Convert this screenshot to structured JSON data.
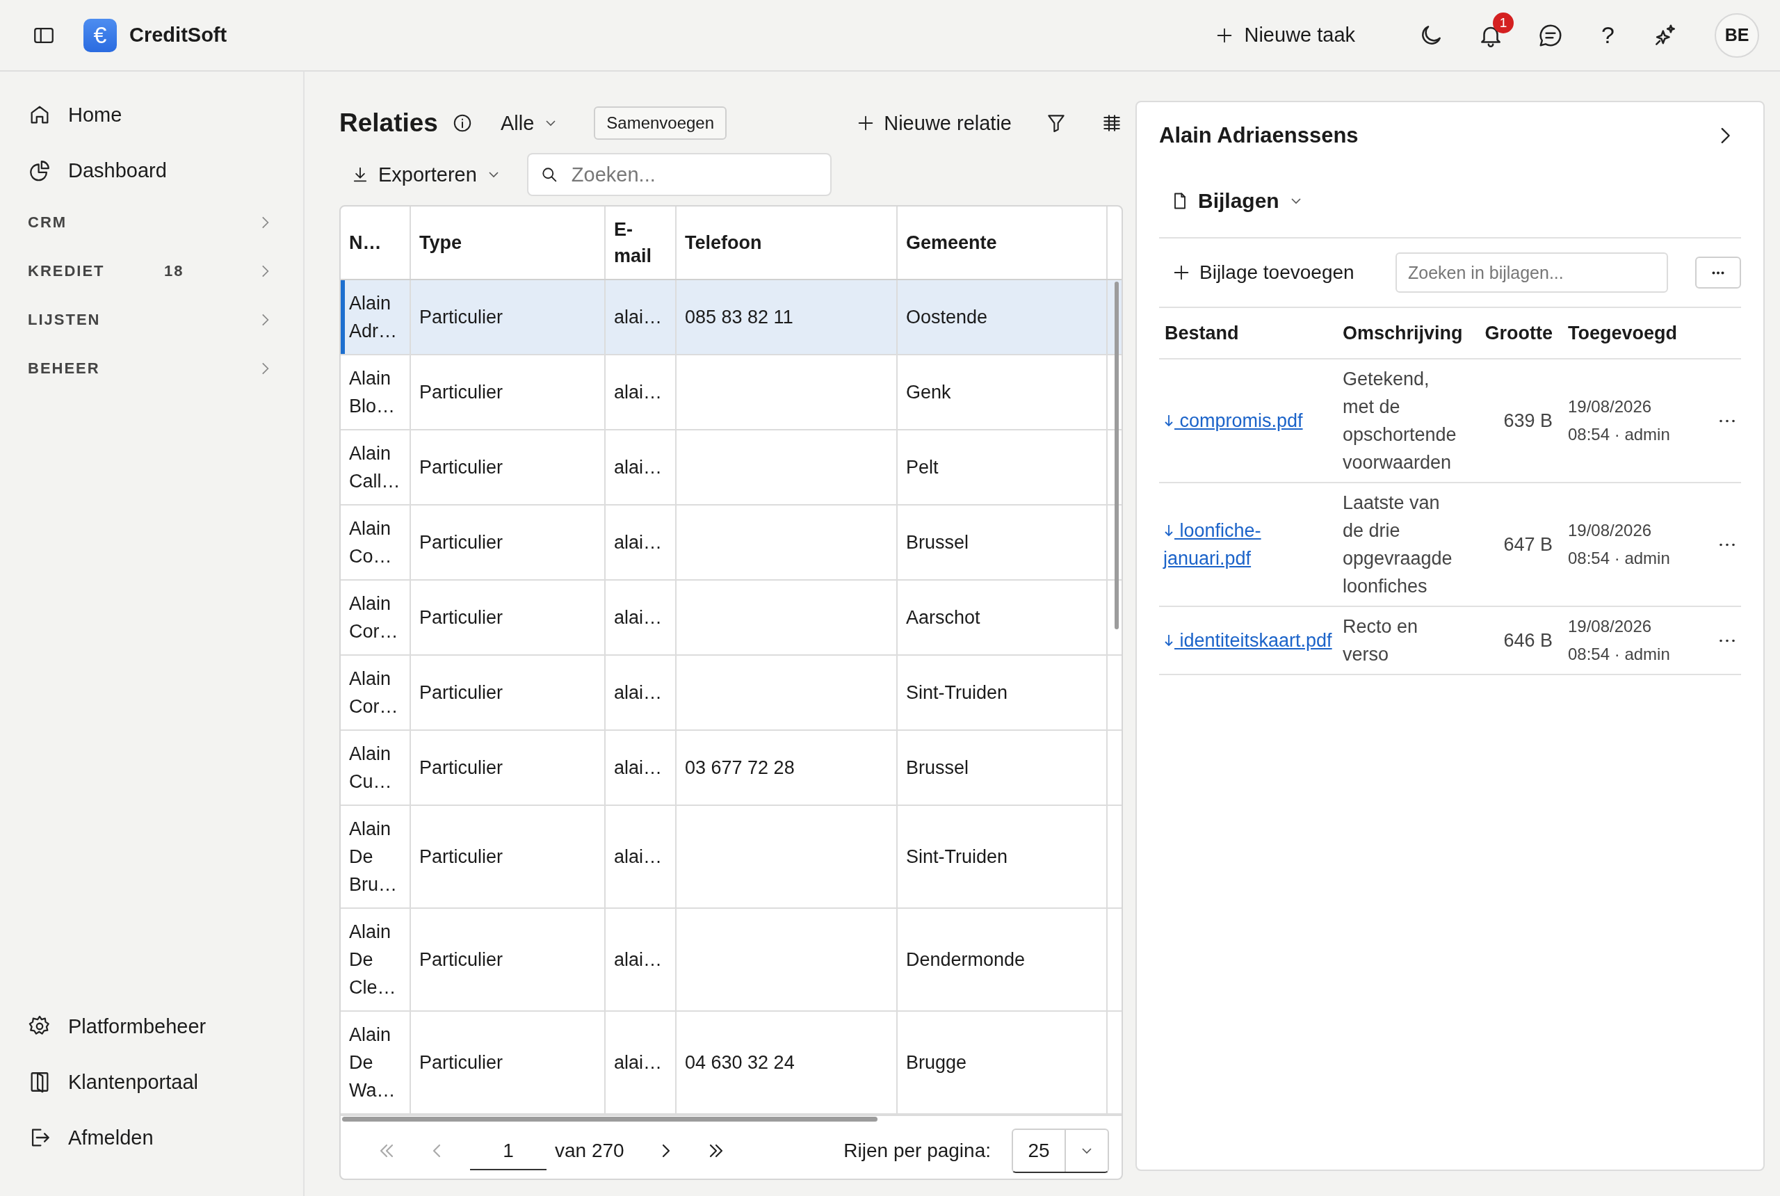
{
  "topbar": {
    "logo_symbol": "€",
    "app_name": "CreditSoft",
    "new_task": "Nieuwe taak",
    "notification_count": "1",
    "help": "?",
    "avatar": "BE"
  },
  "sidebar": {
    "top_items": [
      {
        "label": "Home"
      },
      {
        "label": "Dashboard"
      }
    ],
    "sections": [
      {
        "label": "CRM",
        "expanded": false
      },
      {
        "label": "KREDIET",
        "count": "18",
        "expanded": false
      },
      {
        "label": "LIJSTEN",
        "expanded": false
      },
      {
        "label": "BEHEER",
        "expanded": false
      }
    ],
    "bottom_items": [
      {
        "label": "Platformbeheer"
      },
      {
        "label": "Klantenportaal"
      },
      {
        "label": "Afmelden"
      }
    ]
  },
  "relaties": {
    "title": "Relaties",
    "filter": "Alle",
    "merge": "Samenvoegen",
    "new": "Nieuwe relatie",
    "export": "Exporteren",
    "search_placeholder": "Zoeken...",
    "columns": [
      "N…",
      "Type",
      "E-mail",
      "Telefoon",
      "Gemeente"
    ],
    "rows": [
      {
        "name": "Alain Adr…",
        "type": "Particulier",
        "email": "alai…",
        "phone": "085 83 82 11",
        "city": "Oostende",
        "selected": true
      },
      {
        "name": "Alain Blo…",
        "type": "Particulier",
        "email": "alai…",
        "phone": "",
        "city": "Genk",
        "selected": false
      },
      {
        "name": "Alain Call…",
        "type": "Particulier",
        "email": "alai…",
        "phone": "",
        "city": "Pelt",
        "selected": false
      },
      {
        "name": "Alain Co…",
        "type": "Particulier",
        "email": "alai…",
        "phone": "",
        "city": "Brussel",
        "selected": false
      },
      {
        "name": "Alain Cor…",
        "type": "Particulier",
        "email": "alai…",
        "phone": "",
        "city": "Aarschot",
        "selected": false
      },
      {
        "name": "Alain Cor…",
        "type": "Particulier",
        "email": "alai…",
        "phone": "",
        "city": "Sint-Truiden",
        "selected": false
      },
      {
        "name": "Alain Cu…",
        "type": "Particulier",
        "email": "alai…",
        "phone": "03 677 72 28",
        "city": "Brussel",
        "selected": false
      },
      {
        "name": "Alain De Bru…",
        "type": "Particulier",
        "email": "alai…",
        "phone": "",
        "city": "Sint-Truiden",
        "selected": false
      },
      {
        "name": "Alain De Cle…",
        "type": "Particulier",
        "email": "alai…",
        "phone": "",
        "city": "Dendermonde",
        "selected": false
      },
      {
        "name": "Alain De Wa…",
        "type": "Particulier",
        "email": "alai…",
        "phone": "04 630 32 24",
        "city": "Brugge",
        "selected": false
      }
    ],
    "pagination": {
      "nav": [
        {
          "disabled": true
        },
        {
          "disabled": true
        },
        {
          "disabled": false
        },
        {
          "disabled": false
        }
      ],
      "page": "1",
      "of": "van 270",
      "rows_label": "Rijen per pagina:",
      "rows_per_page": "25"
    }
  },
  "detail": {
    "title": "Alain Adriaenssens",
    "section": "Bijlagen",
    "add": "Bijlage toevoegen",
    "search_placeholder": "Zoeken in bijlagen...",
    "columns": [
      "Bestand",
      "Omschrijving",
      "Grootte",
      "Toegevoegd"
    ],
    "files": [
      {
        "name": "compromis.pdf",
        "description": "Getekend, met de opschortende voorwaarden",
        "size": "639 B",
        "added": "19/08/2026 08:54 · admin"
      },
      {
        "name": "loonfiche-januari.pdf",
        "description": "Laatste van de drie opgevraagde loonfiches",
        "size": "647 B",
        "added": "19/08/2026 08:54 · admin"
      },
      {
        "name": "identiteitskaart.pdf",
        "description": "Recto en verso",
        "size": "646 B",
        "added": "19/08/2026 08:54 · admin"
      }
    ]
  }
}
